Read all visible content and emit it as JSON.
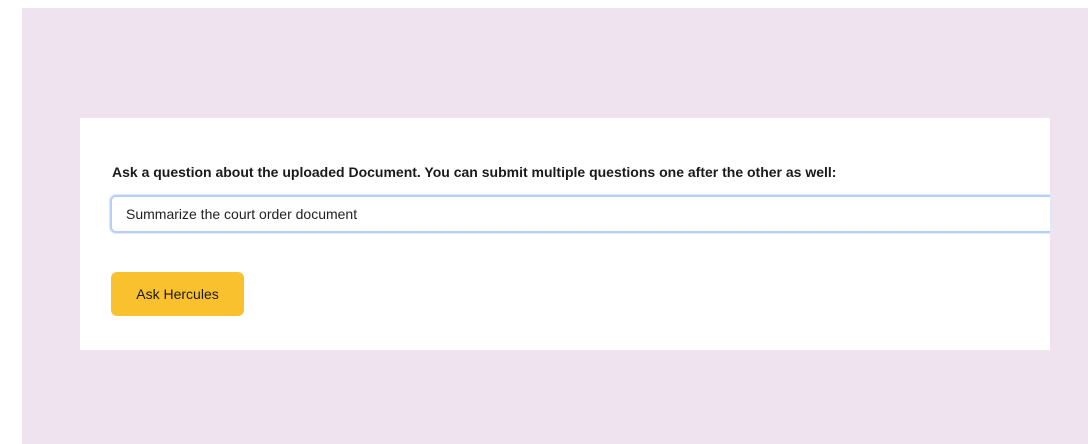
{
  "qa": {
    "label": "Ask a question about the uploaded Document. You can submit multiple questions one after the other as well:",
    "input_value": "Summarize the court order document",
    "button_label": "Ask Hercules"
  },
  "colors": {
    "background": "#efe3ef",
    "card": "#ffffff",
    "input_border": "#b7cff7",
    "button": "#f9c12d"
  }
}
